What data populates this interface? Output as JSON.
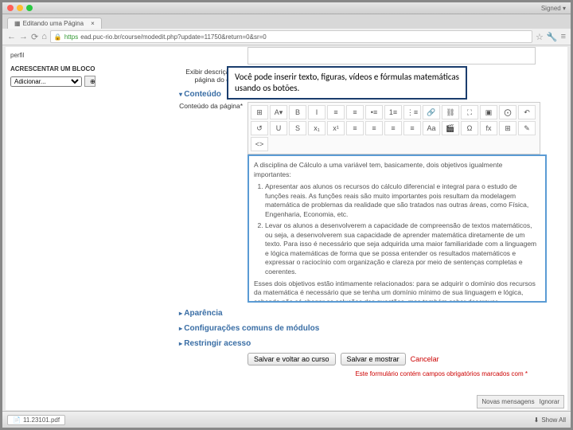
{
  "window": {
    "title": "Editando uma Página",
    "account": "Signed ▾"
  },
  "url": {
    "scheme": "https",
    "text": "ead.puc-rio.br/course/modedit.php?update=11750&return=0&sr=0"
  },
  "sidebar": {
    "perfil": "perfil",
    "blockHead": "ACRESCENTAR UM BLOCO",
    "addLabel": "Adicionar..."
  },
  "callout": "Você pode inserir texto, figuras, vídeos e fórmulas matemáticas usando os botões.",
  "labels": {
    "exibir": "Exibir descrição na página do curso",
    "conteudo": "Conteúdo",
    "pagina": "Conteúdo da página",
    "aparencia": "Aparência",
    "config": "Configurações comuns de módulos",
    "restringir": "Restringir acesso"
  },
  "toolbar": [
    "⊞",
    "A▾",
    "B",
    "I",
    "≡",
    "≡",
    "•≡",
    "1≡",
    "⋮≡",
    "🔗",
    "⛓",
    "⛶",
    "▣",
    "⨀",
    "↶",
    "↺",
    "U",
    "S",
    "x₁",
    "x¹",
    "≡",
    "≡",
    "≡",
    "≡",
    "Aa",
    "🎬",
    "Ω",
    "fx",
    "⊞",
    "✎",
    "<>"
  ],
  "content": {
    "intro": "A disciplina de Cálculo a uma variável tem, basicamente, dois objetivos igualmente importantes:",
    "li1": "Apresentar aos alunos os recursos do cálculo diferencial e integral para o estudo de funções reais. As funções reais são muito importantes pois resultam da modelagem matemática de problemas da realidade que são tratados nas outras áreas, como Física, Engenharia, Economia, etc.",
    "li2": "Levar os alunos a desenvolverem a capacidade de compreensão de textos matemáticos, ou seja, a desenvolverem sua capacidade de aprender matemática diretamente de um texto. Para isso é necessário que seja adquirida uma maior familiaridade com a linguagem e lógica matemáticas de forma que se possa entender os resultados matemáticos e  expressar o raciocínio com organização e clareza por meio de sentenças completas e coerentes.",
    "outro": "Esses dois objetivos estão intimamente relacionados: para se adquirir o domínio dos recursos da matemática é necessário que se tenha um domínio mínimo de sua linguagem e lógica, sabendo não só chegar as soluções das questões, mas também saber descrever"
  },
  "actions": {
    "save1": "Salvar e voltar ao curso",
    "save2": "Salvar e mostrar",
    "cancel": "Cancelar",
    "note": "Este formulário contém campos obrigatórios marcados com *"
  },
  "notif": {
    "msg": "Novas mensagens",
    "ignore": "Ignorar"
  },
  "footer": {
    "file": "11.23101.pdf",
    "showall": "Show All"
  }
}
